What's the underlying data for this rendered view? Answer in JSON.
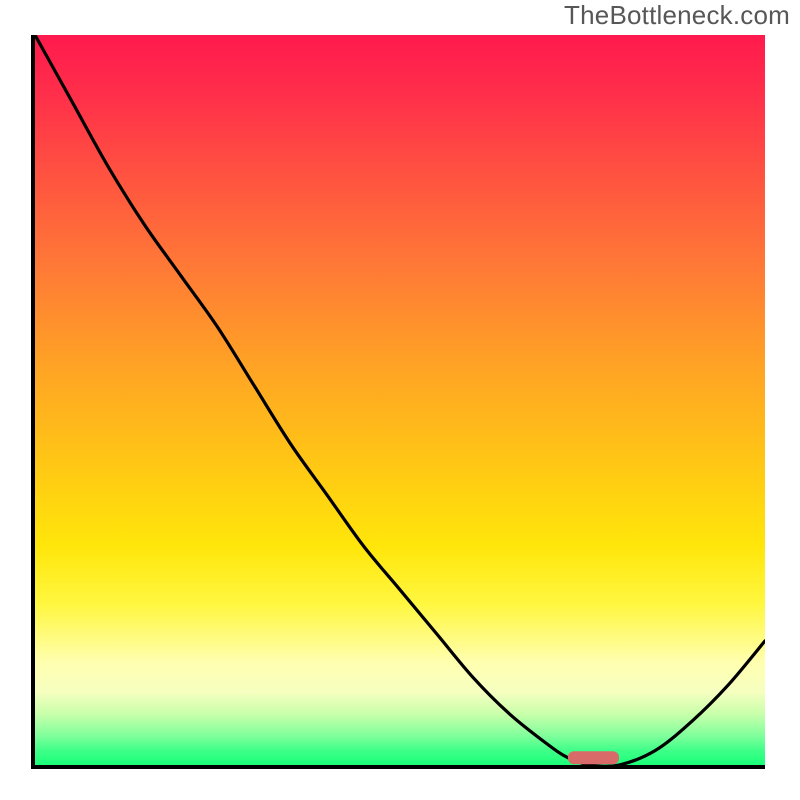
{
  "watermark": "TheBottleneck.com",
  "chart_data": {
    "type": "line",
    "title": "",
    "xlabel": "",
    "ylabel": "",
    "grid": false,
    "x": [
      0.0,
      0.05,
      0.1,
      0.15,
      0.2,
      0.25,
      0.3,
      0.35,
      0.4,
      0.45,
      0.5,
      0.55,
      0.6,
      0.65,
      0.7,
      0.73,
      0.76,
      0.8,
      0.85,
      0.9,
      0.95,
      1.0
    ],
    "values": [
      1.0,
      0.91,
      0.82,
      0.74,
      0.67,
      0.6,
      0.52,
      0.44,
      0.37,
      0.3,
      0.24,
      0.18,
      0.12,
      0.07,
      0.03,
      0.01,
      0.0,
      0.0,
      0.02,
      0.06,
      0.11,
      0.17
    ],
    "xlim": [
      0,
      1
    ],
    "ylim": [
      0,
      1
    ],
    "marker": {
      "x_start": 0.73,
      "x_end": 0.8,
      "y": 0.01,
      "color": "#d86a6a"
    },
    "background_gradient": {
      "orientation": "vertical",
      "stops": [
        {
          "pos": 0.0,
          "color": "#ff1a4d"
        },
        {
          "pos": 0.2,
          "color": "#ff5540"
        },
        {
          "pos": 0.45,
          "color": "#ffa225"
        },
        {
          "pos": 0.7,
          "color": "#ffe60a"
        },
        {
          "pos": 0.86,
          "color": "#ffffb0"
        },
        {
          "pos": 0.93,
          "color": "#c8ffaa"
        },
        {
          "pos": 1.0,
          "color": "#1aff79"
        }
      ]
    }
  }
}
